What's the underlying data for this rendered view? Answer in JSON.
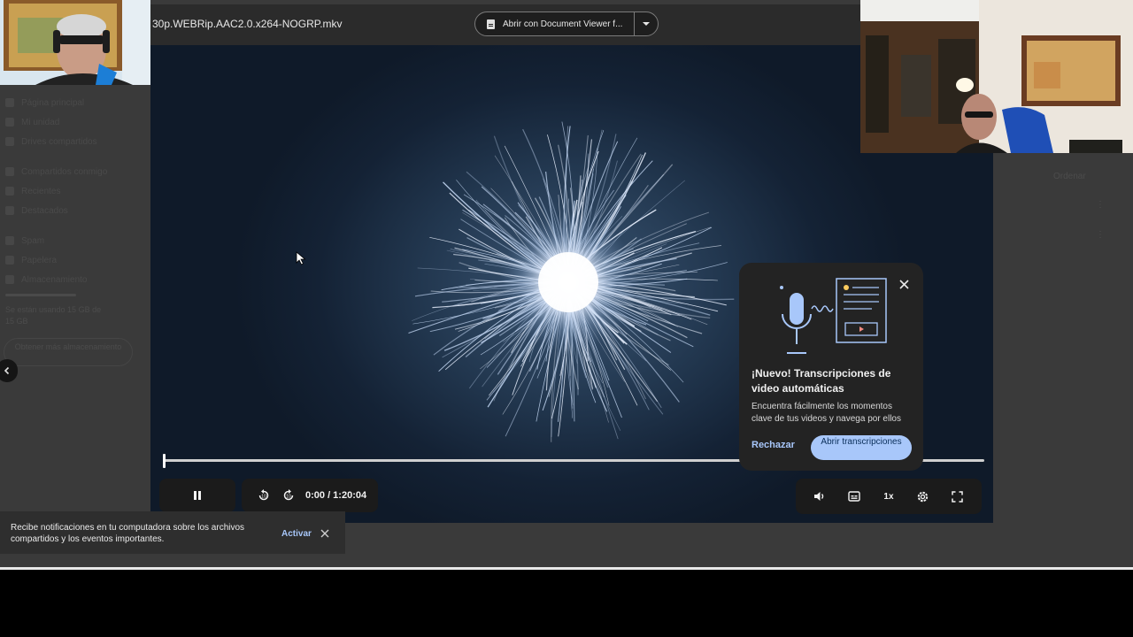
{
  "topbar": {
    "file_title": "30p.WEBRip.AAC2.0.x264-NOGRP.mkv",
    "open_with_label": "Abrir con Document Viewer f...",
    "open_with_icon": "document-icon"
  },
  "sidebar": {
    "items": [
      {
        "label": "Página principal"
      },
      {
        "label": "Mi unidad"
      },
      {
        "label": "Drives compartidos"
      },
      {
        "label": "Compartidos conmigo"
      },
      {
        "label": "Recientes"
      },
      {
        "label": "Destacados"
      },
      {
        "label": "Spam"
      },
      {
        "label": "Papelera"
      },
      {
        "label": "Almacenamiento"
      }
    ],
    "storage_text": "Se están usando 15 GB de 15 GB",
    "storage_button": "Obtener más almacenamiento"
  },
  "right_panel": {
    "sort_label": "Ordenar",
    "more": "⋮"
  },
  "player": {
    "time_display": "0:00 / 1:20:04",
    "speed_label": "1x",
    "progress": 0.0,
    "icons": [
      "pause-icon",
      "rewind-10-icon",
      "forward-10-icon",
      "volume-icon",
      "captions-icon",
      "settings-icon",
      "fullscreen-icon"
    ]
  },
  "popup": {
    "title": "¡Nuevo! Transcripciones de video automáticas",
    "body": "Encuentra fácilmente los momentos clave de tus videos y navega por ellos",
    "reject_label": "Rechazar",
    "open_label": "Abrir transcripciones",
    "accent_color": "#a8c7fa"
  },
  "toast": {
    "text": "Recibe notificaciones en tu computadora sobre los archivos compartidos y los eventos importantes.",
    "action_label": "Activar"
  },
  "colors": {
    "app_bg": "#3a3a3a",
    "topbar_bg": "#2b2b2b",
    "control_bg": "#1b1b1b",
    "accent": "#a8c7fa"
  }
}
